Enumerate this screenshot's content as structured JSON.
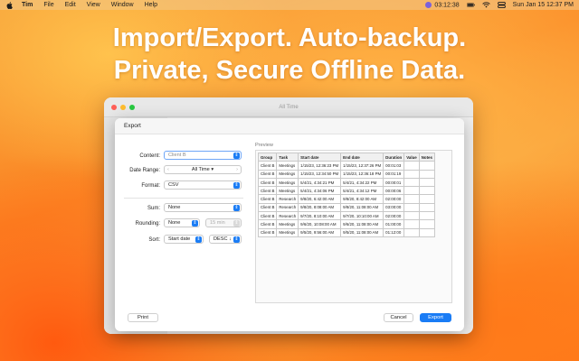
{
  "menubar": {
    "app_name": "Tim",
    "items": [
      "File",
      "Edit",
      "View",
      "Window",
      "Help"
    ],
    "timer": "03:12:38",
    "datetime": "Sun Jan 15  12:37 PM"
  },
  "headline": {
    "line1": "Import/Export.  Auto-backup.",
    "line2": "Private, Secure Offline Data."
  },
  "app_window": {
    "title": "All Time"
  },
  "sheet": {
    "title": "Export",
    "form": {
      "content_label": "Content:",
      "content_value": "Client B",
      "date_range_label": "Date Range:",
      "date_range_value": "All Time",
      "format_label": "Format:",
      "format_value": "CSV",
      "sum_label": "Sum:",
      "sum_value": "None",
      "rounding_label": "Rounding:",
      "rounding_value": "None",
      "rounding_minutes": "15 min",
      "sort_label": "Sort:",
      "sort_value": "Start date",
      "sort_order": "DESC"
    },
    "preview": {
      "label": "Preview",
      "columns": [
        "Group",
        "Task",
        "Start date",
        "End date",
        "Duration",
        "Value",
        "Notes"
      ],
      "rows": [
        [
          "Client B",
          "Meetings",
          "1/15/23, 12:36:23 PM",
          "1/15/23, 12:37:26 PM",
          "00:01:03",
          "",
          ""
        ],
        [
          "Client B",
          "Meetings",
          "1/15/23, 12:34:50 PM",
          "1/15/23, 12:36:18 PM",
          "00:01:19",
          "",
          ""
        ],
        [
          "Client B",
          "Meetings",
          "5/4/21, 4:34:21 PM",
          "5/4/21, 4:34:22 PM",
          "00:00:01",
          "",
          ""
        ],
        [
          "Client B",
          "Meetings",
          "5/4/21, 4:34:06 PM",
          "5/4/21, 4:34:12 PM",
          "00:00:06",
          "",
          ""
        ],
        [
          "Client B",
          "Research",
          "9/8/20, 6:42:00 AM",
          "9/8/20, 8:42:00 AM",
          "02:00:00",
          "",
          ""
        ],
        [
          "Client B",
          "Research",
          "9/8/20, 8:08:00 AM",
          "9/8/20, 11:08:00 AM",
          "03:00:00",
          "",
          ""
        ],
        [
          "Client B",
          "Research",
          "9/7/20, 8:10:00 AM",
          "9/7/20, 10:10:00 AM",
          "02:00:00",
          "",
          ""
        ],
        [
          "Client B",
          "Meetings",
          "9/6/20, 10:08:00 AM",
          "9/6/20, 11:08:00 AM",
          "01:00:00",
          "",
          ""
        ],
        [
          "Client B",
          "Meetings",
          "9/5/20, 9:56:00 AM",
          "9/5/20, 11:08:00 AM",
          "01:12:00",
          "",
          ""
        ]
      ]
    },
    "buttons": {
      "print": "Print",
      "cancel": "Cancel",
      "export": "Export"
    }
  },
  "colors": {
    "accent": "#1a7cf5",
    "timer_dot": "#7b61d9"
  }
}
